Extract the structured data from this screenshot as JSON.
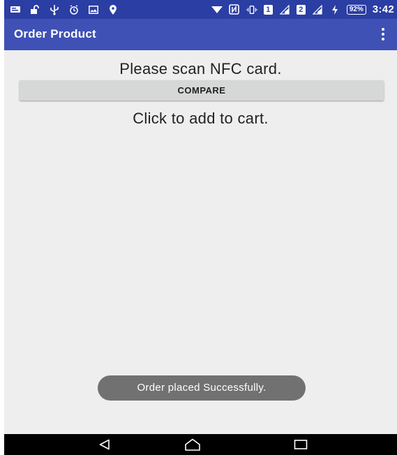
{
  "status_bar": {
    "icons_left": [
      "notification-icon",
      "lock-open-icon",
      "usb-icon",
      "alarm-icon",
      "image-icon",
      "map-pin-icon"
    ],
    "icons_right": [
      "wifi-icon",
      "nfc-icon",
      "vibrate-icon",
      "sim1-badge-icon",
      "signal-icon",
      "sim2-badge-icon",
      "signal-icon",
      "charging-icon",
      "battery-icon"
    ],
    "sim1_label": "1",
    "sim2_label": "2",
    "battery_percent": "92%",
    "time": "3:42"
  },
  "app_bar": {
    "title": "Order Product",
    "menu_icon": "overflow-menu-icon"
  },
  "main": {
    "prompt": "Please scan NFC card.",
    "compare_label": "COMPARE",
    "cart_text": "Click to add to cart."
  },
  "toast": {
    "message": "Order placed Successfully."
  },
  "nav_bar": {
    "buttons": [
      "back-icon",
      "home-icon",
      "recents-icon"
    ]
  },
  "colors": {
    "status_bar": "#2b3ea3",
    "app_bar": "#3f51b5",
    "background": "#eeeeee",
    "button": "#d6d7d7",
    "toast": "#717171",
    "nav_bar": "#000000"
  }
}
